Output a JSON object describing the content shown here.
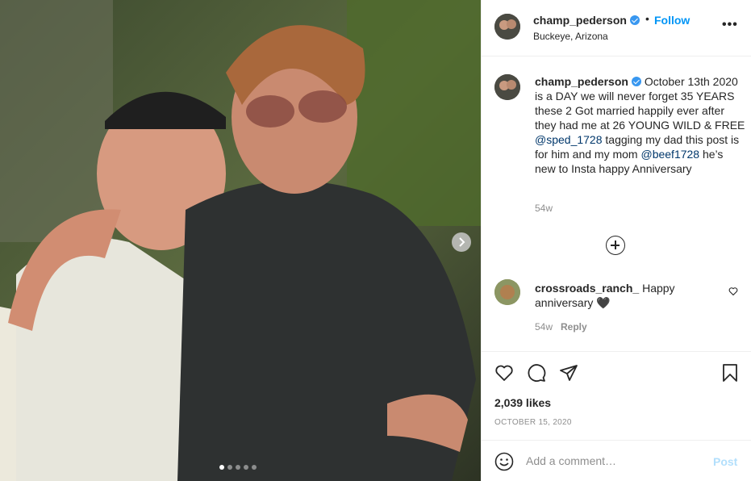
{
  "post": {
    "username": "champ_pederson",
    "follow_label": "Follow",
    "separator": "•",
    "location": "Buckeye, Arizona",
    "more_label": "•••",
    "photo_slide_count": 5,
    "photo_active_slide": 1
  },
  "caption": {
    "username": "champ_pederson",
    "text_1": " October 13th 2020 is a DAY we will never forget 35 YEARS these 2 Got married happily ever after they had me at 26 YOUNG WILD & FREE ",
    "mention_1": "@sped_1728",
    "text_2": " tagging my dad this post is for him and my mom ",
    "mention_2": "@beef1728",
    "text_3": " he’s new to Insta happy Anniversary",
    "time": "54w"
  },
  "comments": [
    {
      "username": "crossroads_ranch_",
      "text": " Happy anniversary 🖤",
      "time": "54w",
      "reply_label": "Reply"
    }
  ],
  "stats": {
    "likes": "2,039 likes",
    "date": "OCTOBER 15, 2020"
  },
  "add_comment": {
    "placeholder": "Add a comment…",
    "post_label": "Post"
  },
  "icons": [
    "verified-badge-icon",
    "more-options-icon",
    "add-icon",
    "heart-icon",
    "comment-icon",
    "share-icon",
    "bookmark-icon",
    "emoji-icon",
    "chevron-right-icon"
  ],
  "colors": {
    "link": "#0095f6",
    "mention": "#00376b",
    "muted": "#8e8e8e",
    "post_disabled": "#b2dffc"
  }
}
